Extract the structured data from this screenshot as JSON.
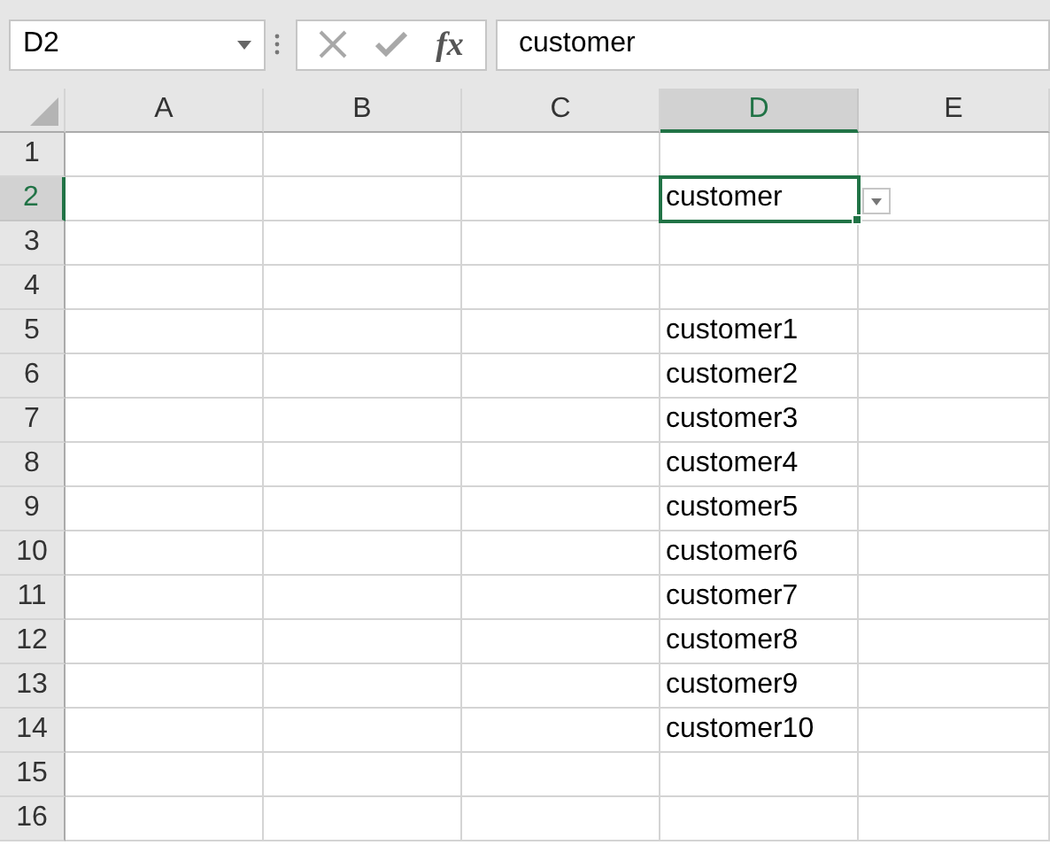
{
  "name_box": {
    "value": "D2"
  },
  "formula_bar": {
    "fx_label": "fx",
    "value": "customer"
  },
  "columns": [
    {
      "label": "A",
      "selected": false
    },
    {
      "label": "B",
      "selected": false
    },
    {
      "label": "C",
      "selected": false
    },
    {
      "label": "D",
      "selected": true
    },
    {
      "label": "E",
      "selected": false
    }
  ],
  "rows": [
    {
      "label": "1",
      "selected": false,
      "cells": [
        null,
        null,
        null,
        null,
        null
      ]
    },
    {
      "label": "2",
      "selected": true,
      "cells": [
        null,
        null,
        null,
        {
          "text": "customer",
          "active": true,
          "dropdown": true
        },
        null
      ]
    },
    {
      "label": "3",
      "selected": false,
      "cells": [
        null,
        null,
        null,
        null,
        null
      ]
    },
    {
      "label": "4",
      "selected": false,
      "cells": [
        null,
        null,
        null,
        null,
        null
      ]
    },
    {
      "label": "5",
      "selected": false,
      "cells": [
        null,
        null,
        null,
        {
          "text": "customer1",
          "active": false,
          "dropdown": false
        },
        null
      ]
    },
    {
      "label": "6",
      "selected": false,
      "cells": [
        null,
        null,
        null,
        {
          "text": "customer2",
          "active": false,
          "dropdown": false
        },
        null
      ]
    },
    {
      "label": "7",
      "selected": false,
      "cells": [
        null,
        null,
        null,
        {
          "text": "customer3",
          "active": false,
          "dropdown": false
        },
        null
      ]
    },
    {
      "label": "8",
      "selected": false,
      "cells": [
        null,
        null,
        null,
        {
          "text": "customer4",
          "active": false,
          "dropdown": false
        },
        null
      ]
    },
    {
      "label": "9",
      "selected": false,
      "cells": [
        null,
        null,
        null,
        {
          "text": "customer5",
          "active": false,
          "dropdown": false
        },
        null
      ]
    },
    {
      "label": "10",
      "selected": false,
      "cells": [
        null,
        null,
        null,
        {
          "text": "customer6",
          "active": false,
          "dropdown": false
        },
        null
      ]
    },
    {
      "label": "11",
      "selected": false,
      "cells": [
        null,
        null,
        null,
        {
          "text": "customer7",
          "active": false,
          "dropdown": false
        },
        null
      ]
    },
    {
      "label": "12",
      "selected": false,
      "cells": [
        null,
        null,
        null,
        {
          "text": "customer8",
          "active": false,
          "dropdown": false
        },
        null
      ]
    },
    {
      "label": "13",
      "selected": false,
      "cells": [
        null,
        null,
        null,
        {
          "text": "customer9",
          "active": false,
          "dropdown": false
        },
        null
      ]
    },
    {
      "label": "14",
      "selected": false,
      "cells": [
        null,
        null,
        null,
        {
          "text": "customer10",
          "active": false,
          "dropdown": false
        },
        null
      ]
    },
    {
      "label": "15",
      "selected": false,
      "cells": [
        null,
        null,
        null,
        null,
        null
      ]
    },
    {
      "label": "16",
      "selected": false,
      "cells": [
        null,
        null,
        null,
        null,
        null
      ]
    }
  ]
}
